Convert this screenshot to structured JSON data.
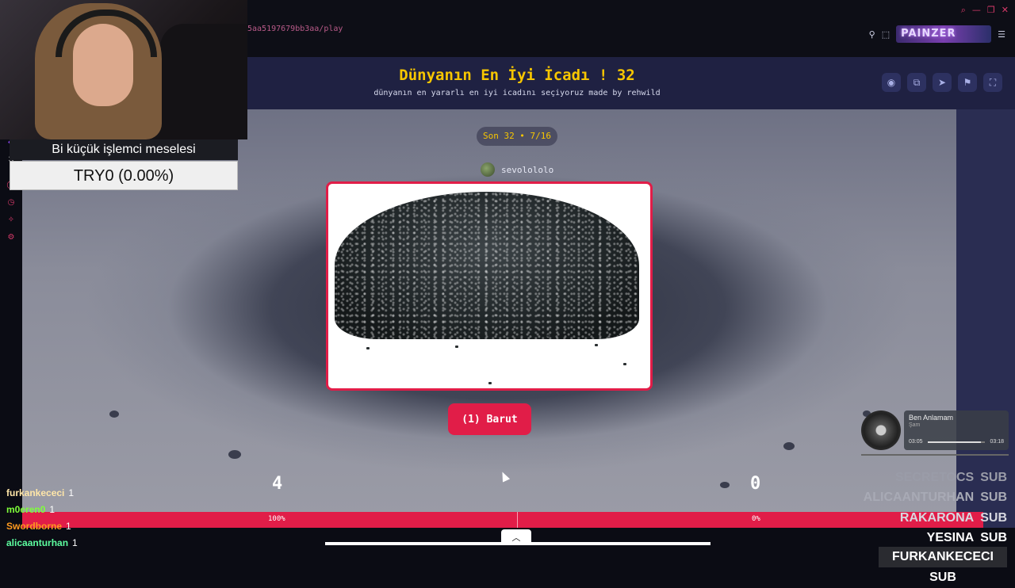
{
  "browser": {
    "url_fragment": "5aa5197679bb3aa/play",
    "extension_logo": "PAINZER"
  },
  "page": {
    "title": "Dünyanın En İyi İcadı ! 32",
    "subtitle": "dünyanın en yararlı en iyi icadını seçiyoruz made by rehwild",
    "header_icons": [
      "eye-icon",
      "share-icon",
      "send-icon",
      "flag-icon",
      "fullscreen-icon"
    ]
  },
  "round": {
    "label": "Son 32 • 7/16",
    "author": "sevolololo",
    "choice_label": "(1) Barut"
  },
  "scores": {
    "left": "4",
    "right": "0",
    "left_percent_label": "100%",
    "right_percent_label": "0%",
    "left_share": 1.0
  },
  "webcam_overlay": {
    "goal_title": "Bi küçük işlemci meselesi",
    "goal_value": "TRY0 (0.00%)"
  },
  "chat": [
    {
      "user": "furkankececi",
      "count": "1",
      "color": "#ffe6a8"
    },
    {
      "user": "m0eren0",
      "count": "1",
      "color": "#7fff3a"
    },
    {
      "user": "Swordborne",
      "count": "1",
      "color": "#ff9a1f"
    },
    {
      "user": "alicaanturhan",
      "count": "1",
      "color": "#5dffa0"
    }
  ],
  "music": {
    "title": "Ben Anlamam",
    "artist": "Şam",
    "elapsed": "03:05",
    "total": "03:18",
    "progress": 0.93
  },
  "subs": [
    {
      "name": "SECRETOCS",
      "tag": "SUB",
      "color": "#9a9ca8"
    },
    {
      "name": "ALICAANTURHAN",
      "tag": "SUB",
      "color": "#a8aab5"
    },
    {
      "name": "RAKARONA",
      "tag": "SUB",
      "color": "#d7d8e0"
    },
    {
      "name": "YESINA",
      "tag": "SUB",
      "color": "#ffffff"
    }
  ],
  "sub_latest": {
    "name": "FURKANKECECI",
    "tag": "SUB"
  },
  "colors": {
    "accent": "#e11d48",
    "title_yellow": "#f7c600",
    "header_bg": "#1f2142"
  }
}
